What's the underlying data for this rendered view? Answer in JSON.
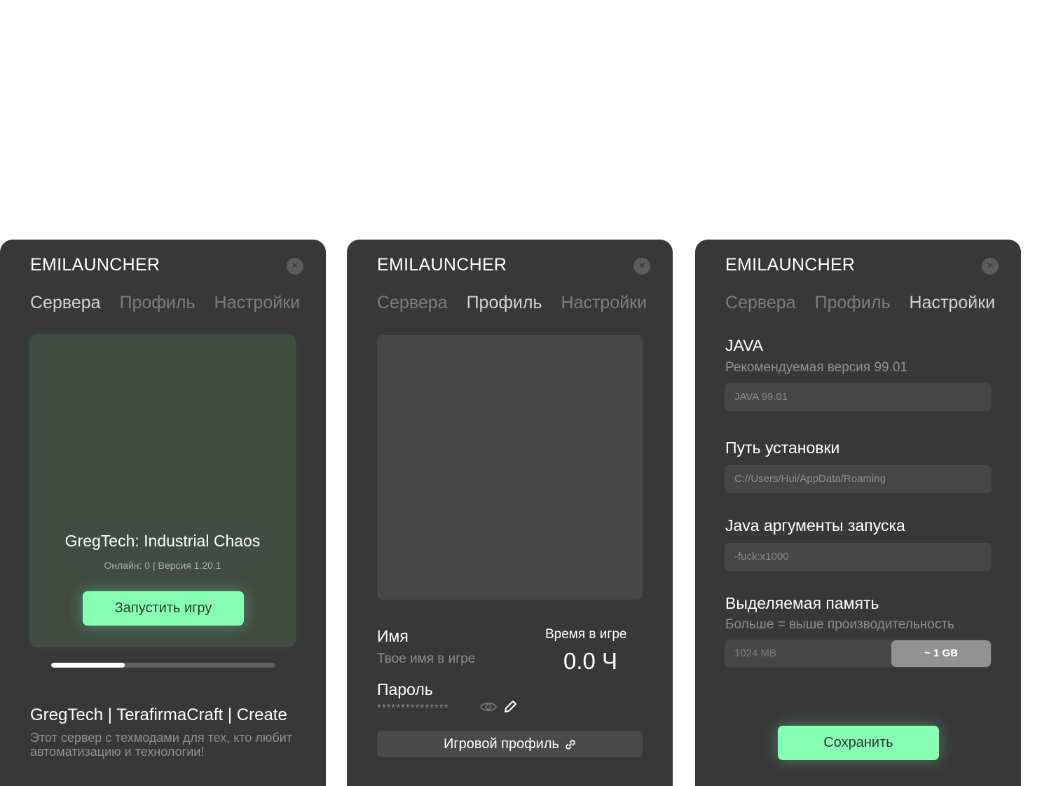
{
  "app": {
    "title": "EMILAUNCHER",
    "close_symbol": "×",
    "tabs": [
      "Сервера",
      "Профиль",
      "Настройки"
    ]
  },
  "servers": {
    "server_name": "GregTech: Industrial Chaos",
    "server_meta": "Онлайн: 0  | Версия 1.20.1",
    "launch_label": "Запустить игру",
    "slide_progress": 0.33,
    "desc_title": "GregTech | TerafirmaCraft | Create",
    "desc_text": "Этот сервер с техмодами для тех, кто любит автоматизацию и технологии!"
  },
  "profile": {
    "name_label": "Имя",
    "name_placeholder": "Твое имя в игре",
    "playtime_label": "Время в игре",
    "playtime_value": "0.0 Ч",
    "password_label": "Пароль",
    "password_mask": "***************",
    "game_profile_label": "Игровой профиль"
  },
  "settings": {
    "java_title": "JAVA",
    "java_recommended": "Рекомендуемая версия 99.01",
    "java_value": "JAVA 99.01",
    "path_title": "Путь установки",
    "path_value": "C://Users/Hui/AppData/Roaming",
    "args_title": "Java аргументы запуска",
    "args_value": "-fuck:x1000",
    "memory_title": "Выделяемая память",
    "memory_hint": "Больше = выше производительность",
    "memory_value": "1024 MB",
    "memory_thumb": "~ 1 GB",
    "save_label": "Сохранить"
  },
  "colors": {
    "panel_bg": "#383838",
    "accent_green": "#86ffb3",
    "tab_active": "#d2d2d2",
    "tab_inactive": "#7c7c7c"
  }
}
